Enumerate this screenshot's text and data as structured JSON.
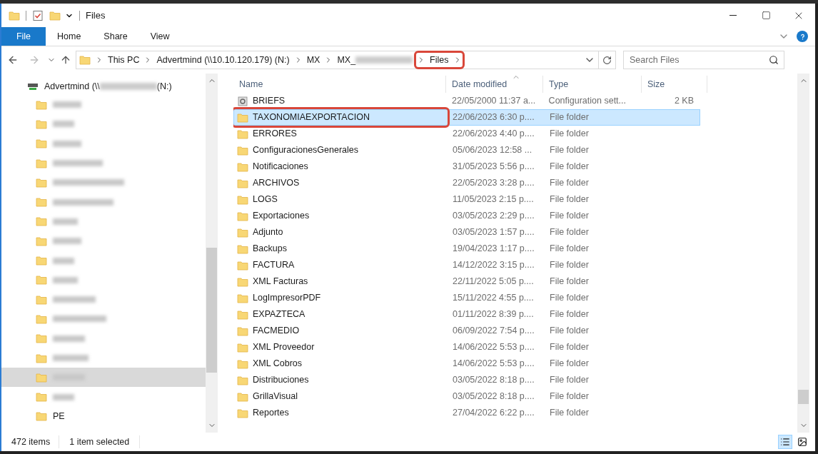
{
  "window": {
    "title": "Files"
  },
  "ribbon_tabs": [
    {
      "label": "File",
      "kind": "menu"
    },
    {
      "label": "Home",
      "kind": "tab",
      "selected": false
    },
    {
      "label": "Share",
      "kind": "tab",
      "selected": false
    },
    {
      "label": "View",
      "kind": "tab",
      "selected": false
    }
  ],
  "breadcrumb": [
    {
      "kind": "text",
      "label": "This PC",
      "highlighted": false
    },
    {
      "kind": "text",
      "label": "Advertmind (\\\\10.10.120.179) (N:)",
      "highlighted": false
    },
    {
      "kind": "text",
      "label": "MX",
      "highlighted": false
    },
    {
      "kind": "partly_hidden",
      "label": "MX_",
      "highlighted": false
    },
    {
      "kind": "text",
      "label": "Files",
      "highlighted": true
    }
  ],
  "search": {
    "placeholder": "Search Files"
  },
  "tree": {
    "root": {
      "label": "Advertmind (\\\\",
      "suffix": "(N:)"
    },
    "children": [
      {
        "kind": "hidden",
        "selected": false
      },
      {
        "kind": "hidden",
        "selected": false
      },
      {
        "kind": "hidden",
        "selected": false
      },
      {
        "kind": "hidden",
        "selected": false
      },
      {
        "kind": "hidden",
        "selected": false
      },
      {
        "kind": "hidden",
        "selected": false
      },
      {
        "kind": "hidden",
        "selected": false
      },
      {
        "kind": "hidden",
        "selected": false
      },
      {
        "kind": "hidden",
        "selected": false
      },
      {
        "kind": "hidden",
        "selected": false
      },
      {
        "kind": "hidden",
        "selected": false
      },
      {
        "kind": "hidden",
        "selected": false
      },
      {
        "kind": "hidden",
        "selected": false
      },
      {
        "kind": "hidden",
        "selected": false
      },
      {
        "kind": "hidden",
        "selected": true
      },
      {
        "kind": "hidden",
        "selected": false
      },
      {
        "kind": "folder",
        "label": "PE",
        "selected": false
      }
    ]
  },
  "table": {
    "columns": [
      "Name",
      "Date modified",
      "Type",
      "Size"
    ],
    "rows": [
      {
        "kind": "config",
        "name": "BRIEFS",
        "date": "22/05/2000 11:37 a...",
        "type": "Configuration sett...",
        "size": "2 KB",
        "selected": false,
        "highlighted": false
      },
      {
        "kind": "folder",
        "name": "TAXONOMIAEXPORTACION",
        "date": "22/06/2023 6:30 p....",
        "type": "File folder",
        "selected": true,
        "highlighted": true
      },
      {
        "kind": "folder",
        "name": "ERRORES",
        "date": "22/06/2023 4:40 p....",
        "type": "File folder",
        "selected": false,
        "highlighted": false
      },
      {
        "kind": "folder",
        "name": "ConfiguracionesGenerales",
        "date": "05/06/2023 12:58 ...",
        "type": "File folder",
        "selected": false,
        "highlighted": false
      },
      {
        "kind": "folder",
        "name": "Notificaciones",
        "date": "31/05/2023 5:56 p....",
        "type": "File folder",
        "selected": false,
        "highlighted": false
      },
      {
        "kind": "folder",
        "name": "ARCHIVOS",
        "date": "22/05/2023 3:28 p....",
        "type": "File folder",
        "selected": false,
        "highlighted": false
      },
      {
        "kind": "folder",
        "name": "LOGS",
        "date": "11/05/2023 2:15 p....",
        "type": "File folder",
        "selected": false,
        "highlighted": false
      },
      {
        "kind": "folder",
        "name": "Exportaciones",
        "date": "03/05/2023 2:29 p....",
        "type": "File folder",
        "selected": false,
        "highlighted": false
      },
      {
        "kind": "folder",
        "name": "Adjunto",
        "date": "03/05/2023 1:57 p....",
        "type": "File folder",
        "selected": false,
        "highlighted": false
      },
      {
        "kind": "folder",
        "name": "Backups",
        "date": "19/04/2023 1:17 p....",
        "type": "File folder",
        "selected": false,
        "highlighted": false
      },
      {
        "kind": "folder",
        "name": "FACTURA",
        "date": "14/12/2022 3:15 p....",
        "type": "File folder",
        "selected": false,
        "highlighted": false
      },
      {
        "kind": "folder",
        "name": "XML Facturas",
        "date": "22/11/2022 5:05 p....",
        "type": "File folder",
        "selected": false,
        "highlighted": false
      },
      {
        "kind": "folder",
        "name": "LogImpresorPDF",
        "date": "15/11/2022 4:55 p....",
        "type": "File folder",
        "selected": false,
        "highlighted": false
      },
      {
        "kind": "folder",
        "name": "EXPAZTECA",
        "date": "01/11/2022 8:39 p....",
        "type": "File folder",
        "selected": false,
        "highlighted": false
      },
      {
        "kind": "folder",
        "name": "FACMEDIO",
        "date": "06/09/2022 7:54 p....",
        "type": "File folder",
        "selected": false,
        "highlighted": false
      },
      {
        "kind": "folder",
        "name": "XML Proveedor",
        "date": "14/06/2022 5:53 p....",
        "type": "File folder",
        "selected": false,
        "highlighted": false
      },
      {
        "kind": "folder",
        "name": "XML Cobros",
        "date": "14/06/2022 5:53 p....",
        "type": "File folder",
        "selected": false,
        "highlighted": false
      },
      {
        "kind": "folder",
        "name": "Distribuciones",
        "date": "03/05/2022 8:18 p....",
        "type": "File folder",
        "selected": false,
        "highlighted": false
      },
      {
        "kind": "folder",
        "name": "GrillaVisual",
        "date": "03/05/2022 8:18 p....",
        "type": "File folder",
        "selected": false,
        "highlighted": false
      },
      {
        "kind": "folder",
        "name": "Reportes",
        "date": "27/04/2022 6:22 p....",
        "type": "File folder",
        "selected": false,
        "highlighted": false
      }
    ]
  },
  "status_bar": {
    "count": "472 items",
    "selection": "1 item selected"
  }
}
